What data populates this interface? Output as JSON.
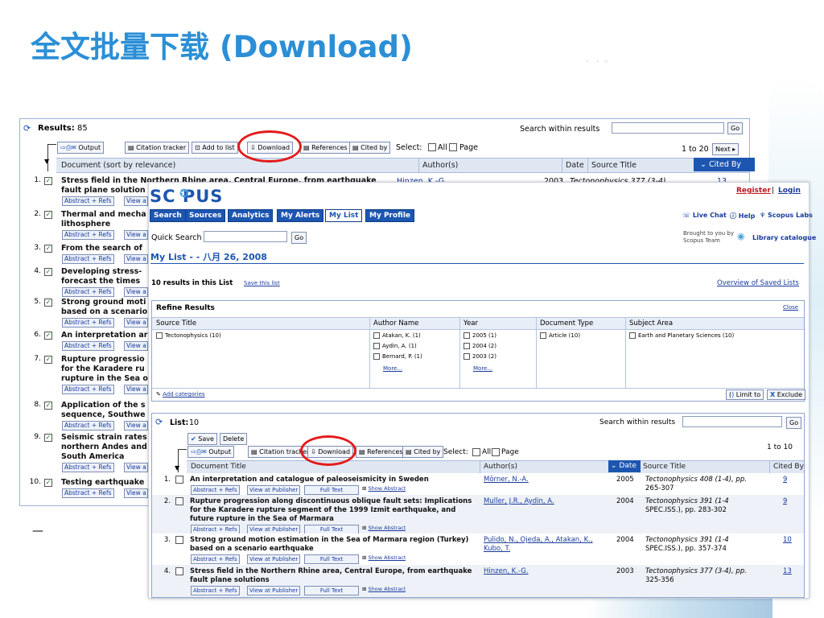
{
  "slide": {
    "title": "全文批量下载 (Download)",
    "dash": "—"
  },
  "back": {
    "results_label": "Results:",
    "results_count": "85",
    "search_within": "Search within results",
    "go": "Go",
    "toolbar": {
      "output": "Output",
      "citation_tracker": "Citation tracker",
      "add_to_list": "Add to list",
      "download": "Download",
      "references": "References",
      "cited_by": "Cited by",
      "select": "Select:",
      "all": "All",
      "page": "Page"
    },
    "paging": {
      "range": "1 to 20",
      "next": "Next"
    },
    "columns": {
      "document": "Document (sort by relevance)",
      "authors": "Author(s)",
      "date": "Date",
      "source": "Source Title",
      "cited_by": "Cited By"
    },
    "row1": {
      "title": "Stress field in the Northern Rhine area, Central Europe, from earthquake",
      "title2": "fault plane solution",
      "author": "Hinzen, K.-G.",
      "date": "2003",
      "source": "Tectonophysics 377 (3-4),",
      "cited": "13"
    },
    "abstract_refs": "Abstract + Refs",
    "view": "View a",
    "rows": [
      {
        "num": "1.",
        "l1": "Stress field in the Northern Rhine area, Central Europe, from earthquake",
        "l2": "fault plane solution",
        "l3": ""
      },
      {
        "num": "2.",
        "l1": "Thermal and mecha",
        "l2": "lithosphere",
        "l3": ""
      },
      {
        "num": "3.",
        "l1": "From the search of",
        "l2": "",
        "l3": ""
      },
      {
        "num": "4.",
        "l1": "Developing stress-",
        "l2": "forecast the times",
        "l3": ""
      },
      {
        "num": "5.",
        "l1": "Strong ground moti",
        "l2": "based on a scenario",
        "l3": ""
      },
      {
        "num": "6.",
        "l1": "An interpretation ar",
        "l2": "",
        "l3": ""
      },
      {
        "num": "7.",
        "l1": "Rupture progressio",
        "l2": "for the Karadere ru",
        "l3": "rupture in the Sea o"
      },
      {
        "num": "8.",
        "l1": "Application of the s",
        "l2": "sequence, Southwe",
        "l3": ""
      },
      {
        "num": "9.",
        "l1": "Seismic strain rates",
        "l2": "northern Andes and",
        "l3": "South America"
      },
      {
        "num": "10.",
        "l1": "Testing earthquake",
        "l2": "",
        "l3": ""
      }
    ]
  },
  "front": {
    "logo": "SC PUS",
    "register": "Register",
    "login": "Login",
    "sep": "|",
    "nav": [
      "Search",
      "Sources",
      "Analytics",
      "My Alerts",
      "My List",
      "My Profile"
    ],
    "live_chat": "Live Chat",
    "help": "Help",
    "labs": "Scopus Labs",
    "quick_search": "Quick Search",
    "go": "Go",
    "brought_by": "Brought to you by",
    "scopus_team": "Scopus Team",
    "library": "Library catalogue",
    "mylist_title": "My List - - 八月 26, 2008",
    "results_in_list": "10 results in this List",
    "save_list": "Save this list",
    "overview": "Overview of Saved Lists",
    "refine": {
      "title": "Refine Results",
      "close": "Close",
      "headers": [
        "Source Title",
        "Author Name",
        "Year",
        "Document Type",
        "Subject Area"
      ],
      "source": [
        "Tectonophysics (10)"
      ],
      "authors": [
        "Atakan, K. (1)",
        "Aydin, A. (1)",
        "Bernard, P. (1)"
      ],
      "years": [
        "2005 (1)",
        "2004 (2)",
        "2003 (2)"
      ],
      "more": "More...",
      "doc_type": [
        "Article (10)"
      ],
      "subject": [
        "Earth and Planetary Sciences (10)"
      ],
      "add_categories": "Add categories",
      "limit_to": "Limit to",
      "exclude": "Exclude"
    },
    "list": {
      "label": "List:",
      "count": "10",
      "search_within": "Search within results",
      "go": "Go",
      "save": "Save",
      "delete": "Delete",
      "toolbar": {
        "output": "Output",
        "citation_tracker": "Citation tracker",
        "download": "Download",
        "references": "References",
        "cited_by": "Cited by",
        "select": "Select:",
        "all": "All",
        "page": "Page"
      },
      "range": "1 to 10",
      "columns": {
        "title": "Document Title",
        "authors": "Author(s)",
        "date": "Date",
        "source": "Source Title",
        "cited": "Cited By"
      },
      "abstract_refs": "Abstract + Refs",
      "view_publisher": "View at Publisher",
      "full_text": "Full Text",
      "show_abstract": "Show Abstract",
      "rows": [
        {
          "num": "1.",
          "l1": "An interpretation and catalogue of paleoseismicity in Sweden",
          "l2": "",
          "l3": "",
          "a1": "Mörner, N.-A.",
          "a2": "",
          "date": "2005",
          "s1": "Tectonophysics 408 (1-4), pp.",
          "s2": "265-307",
          "cited": "9"
        },
        {
          "num": "2.",
          "l1": "Rupture progression along discontinuous oblique fault sets: Implications",
          "l2": "for the Karadere rupture segment of the 1999 Izmit earthquake, and",
          "l3": "future rupture in the Sea of Marmara",
          "a1": "Muller, J.R., Aydin, A.",
          "a2": "",
          "date": "2004",
          "s1": "Tectonophysics 391 (1-4",
          "s2": "SPEC.ISS.), pp. 283-302",
          "cited": "9"
        },
        {
          "num": "3.",
          "l1": "Strong ground motion estimation in the Sea of Marmara region (Turkey)",
          "l2": "based on a scenario earthquake",
          "l3": "",
          "a1": "Pulido, N., Ojeda, A., Atakan, K.,",
          "a2": "Kubo, T.",
          "date": "2004",
          "s1": "Tectonophysics 391 (1-4",
          "s2": "SPEC.ISS.), pp. 357-374",
          "cited": "10"
        },
        {
          "num": "4.",
          "l1": "Stress field in the Northern Rhine area, Central Europe, from earthquake",
          "l2": "fault plane solutions",
          "l3": "",
          "a1": "Hinzen, K.-G.",
          "a2": "",
          "date": "2003",
          "s1": "Tectonophysics 377 (3-4), pp.",
          "s2": "325-356",
          "cited": "13"
        }
      ]
    }
  },
  "colors": {
    "title": "#2b8fd6",
    "nav": "#1d56b0",
    "highlight_ring": "#e31b1b",
    "header_bg": "#dfe7f3"
  }
}
